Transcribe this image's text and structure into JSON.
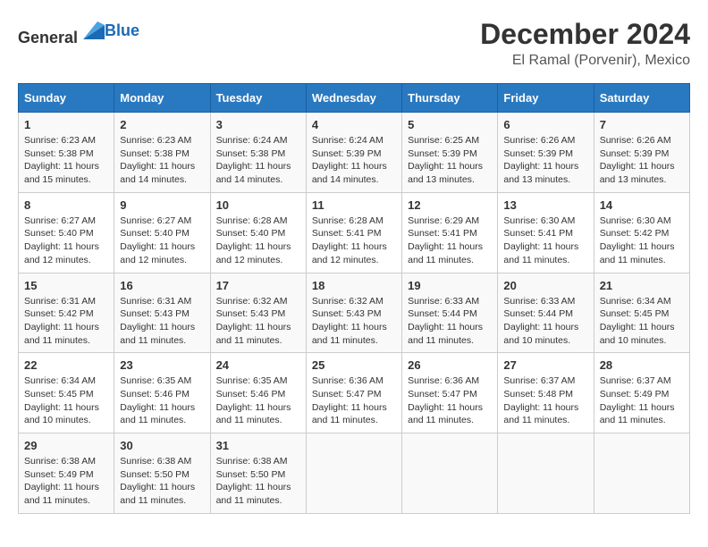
{
  "header": {
    "logo_general": "General",
    "logo_blue": "Blue",
    "title": "December 2024",
    "subtitle": "El Ramal (Porvenir), Mexico"
  },
  "weekdays": [
    "Sunday",
    "Monday",
    "Tuesday",
    "Wednesday",
    "Thursday",
    "Friday",
    "Saturday"
  ],
  "weeks": [
    [
      {
        "day": "1",
        "sunrise": "6:23 AM",
        "sunset": "5:38 PM",
        "daylight": "11 hours and 15 minutes."
      },
      {
        "day": "2",
        "sunrise": "6:23 AM",
        "sunset": "5:38 PM",
        "daylight": "11 hours and 14 minutes."
      },
      {
        "day": "3",
        "sunrise": "6:24 AM",
        "sunset": "5:38 PM",
        "daylight": "11 hours and 14 minutes."
      },
      {
        "day": "4",
        "sunrise": "6:24 AM",
        "sunset": "5:39 PM",
        "daylight": "11 hours and 14 minutes."
      },
      {
        "day": "5",
        "sunrise": "6:25 AM",
        "sunset": "5:39 PM",
        "daylight": "11 hours and 13 minutes."
      },
      {
        "day": "6",
        "sunrise": "6:26 AM",
        "sunset": "5:39 PM",
        "daylight": "11 hours and 13 minutes."
      },
      {
        "day": "7",
        "sunrise": "6:26 AM",
        "sunset": "5:39 PM",
        "daylight": "11 hours and 13 minutes."
      }
    ],
    [
      {
        "day": "8",
        "sunrise": "6:27 AM",
        "sunset": "5:40 PM",
        "daylight": "11 hours and 12 minutes."
      },
      {
        "day": "9",
        "sunrise": "6:27 AM",
        "sunset": "5:40 PM",
        "daylight": "11 hours and 12 minutes."
      },
      {
        "day": "10",
        "sunrise": "6:28 AM",
        "sunset": "5:40 PM",
        "daylight": "11 hours and 12 minutes."
      },
      {
        "day": "11",
        "sunrise": "6:28 AM",
        "sunset": "5:41 PM",
        "daylight": "11 hours and 12 minutes."
      },
      {
        "day": "12",
        "sunrise": "6:29 AM",
        "sunset": "5:41 PM",
        "daylight": "11 hours and 11 minutes."
      },
      {
        "day": "13",
        "sunrise": "6:30 AM",
        "sunset": "5:41 PM",
        "daylight": "11 hours and 11 minutes."
      },
      {
        "day": "14",
        "sunrise": "6:30 AM",
        "sunset": "5:42 PM",
        "daylight": "11 hours and 11 minutes."
      }
    ],
    [
      {
        "day": "15",
        "sunrise": "6:31 AM",
        "sunset": "5:42 PM",
        "daylight": "11 hours and 11 minutes."
      },
      {
        "day": "16",
        "sunrise": "6:31 AM",
        "sunset": "5:43 PM",
        "daylight": "11 hours and 11 minutes."
      },
      {
        "day": "17",
        "sunrise": "6:32 AM",
        "sunset": "5:43 PM",
        "daylight": "11 hours and 11 minutes."
      },
      {
        "day": "18",
        "sunrise": "6:32 AM",
        "sunset": "5:43 PM",
        "daylight": "11 hours and 11 minutes."
      },
      {
        "day": "19",
        "sunrise": "6:33 AM",
        "sunset": "5:44 PM",
        "daylight": "11 hours and 11 minutes."
      },
      {
        "day": "20",
        "sunrise": "6:33 AM",
        "sunset": "5:44 PM",
        "daylight": "11 hours and 10 minutes."
      },
      {
        "day": "21",
        "sunrise": "6:34 AM",
        "sunset": "5:45 PM",
        "daylight": "11 hours and 10 minutes."
      }
    ],
    [
      {
        "day": "22",
        "sunrise": "6:34 AM",
        "sunset": "5:45 PM",
        "daylight": "11 hours and 10 minutes."
      },
      {
        "day": "23",
        "sunrise": "6:35 AM",
        "sunset": "5:46 PM",
        "daylight": "11 hours and 11 minutes."
      },
      {
        "day": "24",
        "sunrise": "6:35 AM",
        "sunset": "5:46 PM",
        "daylight": "11 hours and 11 minutes."
      },
      {
        "day": "25",
        "sunrise": "6:36 AM",
        "sunset": "5:47 PM",
        "daylight": "11 hours and 11 minutes."
      },
      {
        "day": "26",
        "sunrise": "6:36 AM",
        "sunset": "5:47 PM",
        "daylight": "11 hours and 11 minutes."
      },
      {
        "day": "27",
        "sunrise": "6:37 AM",
        "sunset": "5:48 PM",
        "daylight": "11 hours and 11 minutes."
      },
      {
        "day": "28",
        "sunrise": "6:37 AM",
        "sunset": "5:49 PM",
        "daylight": "11 hours and 11 minutes."
      }
    ],
    [
      {
        "day": "29",
        "sunrise": "6:38 AM",
        "sunset": "5:49 PM",
        "daylight": "11 hours and 11 minutes."
      },
      {
        "day": "30",
        "sunrise": "6:38 AM",
        "sunset": "5:50 PM",
        "daylight": "11 hours and 11 minutes."
      },
      {
        "day": "31",
        "sunrise": "6:38 AM",
        "sunset": "5:50 PM",
        "daylight": "11 hours and 11 minutes."
      },
      null,
      null,
      null,
      null
    ]
  ],
  "labels": {
    "sunrise": "Sunrise:",
    "sunset": "Sunset:",
    "daylight": "Daylight:"
  }
}
